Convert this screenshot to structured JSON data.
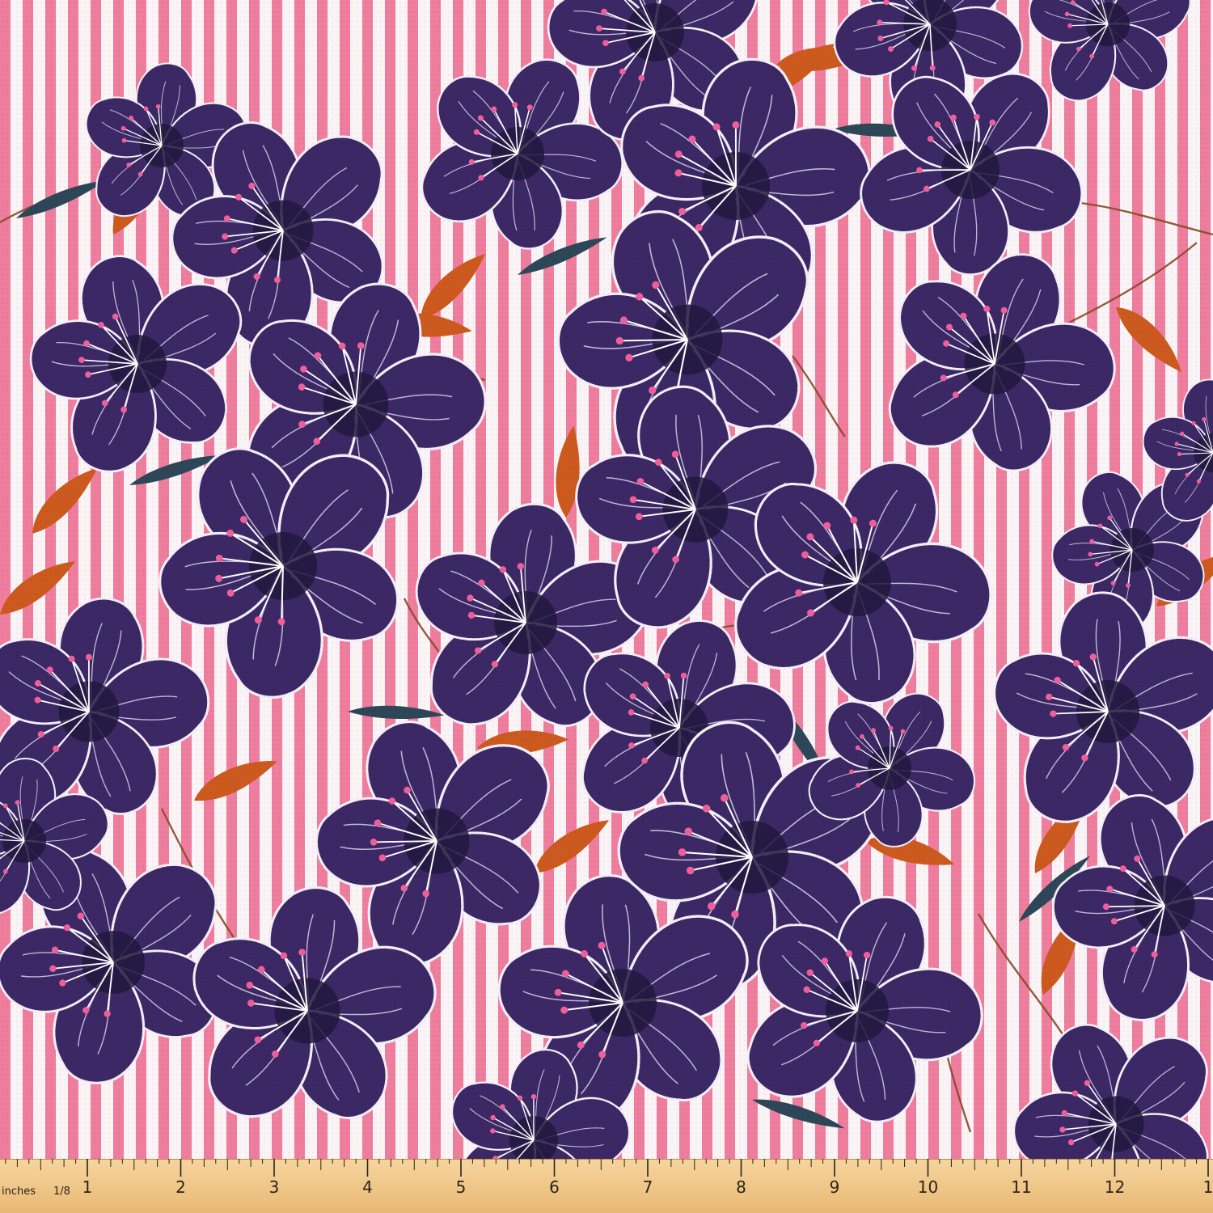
{
  "fabric": {
    "description_colors": {
      "stripe_pink": "#ee7d9e",
      "stripe_white": "#fbf4f6",
      "petal": "#3b2864",
      "petal_dark": "#22173e",
      "outline": "#f3eef8",
      "leaf_orange": "#cc5a1f",
      "leaf_teal": "#2d4759",
      "stamen_tip": "#ef5f9b"
    },
    "icons": [
      "purple-flower-icon",
      "orange-leaf-icon",
      "teal-leaf-icon"
    ]
  },
  "ruler": {
    "unit_label": "inches",
    "fraction_label": "1/8",
    "numbers": [
      "1",
      "2",
      "3",
      "4",
      "5",
      "6",
      "7",
      "8",
      "9",
      "10",
      "11",
      "12",
      "1"
    ],
    "colors": {
      "wood": "#f3c98a",
      "wood_dark": "#e1b270",
      "ink": "#2b2418"
    }
  }
}
